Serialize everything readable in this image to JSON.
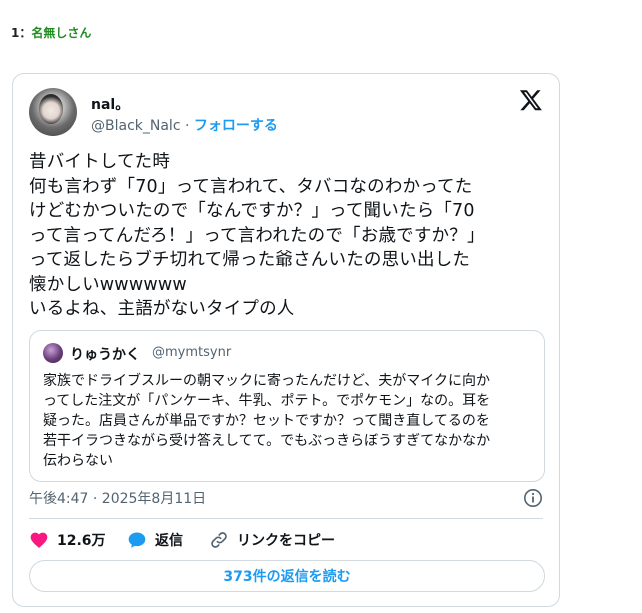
{
  "post": {
    "number": "1",
    "separator": "：",
    "author": "名無しさん"
  },
  "tweet": {
    "user_name": "nal。",
    "handle": "@Black_Nalc",
    "dot": "·",
    "follow_label": "フォローする",
    "text": "昔バイトしてた時\n何も言わず「70」って言われて、タバコなのわかってた\nけどむかついたので「なんですか？」って聞いたら「70\nって言ってんだろ！」って言われたので「お歳ですか？」\nって返したらブチ切れて帰った爺さんいたの思い出した\n懐かしいwwwwww\nいるよね、主語がないタイプの人",
    "quote": {
      "user_name": "りゅうかく",
      "handle": "@mymtsynr",
      "text": "家族でドライブスルーの朝マックに寄ったんだけど、夫がマイクに向か\nってした注文が「パンケーキ、牛乳、ポテト。でポケモン」なの。耳を\n疑った。店員さんが単品ですか？セットですか？って聞き直してるのを\n若干イラつきながら受け答えしてて。でもぶっきらぼうすぎてなかなか\n伝わらない"
    },
    "timestamp": "午後4:47 · 2025年8月11日",
    "likes": "12.6万",
    "reply_label": "返信",
    "copy_link_label": "リンクをコピー",
    "read_replies_label": "373件の返信を読む"
  },
  "icons": {
    "x_logo": "x-logo-icon",
    "info": "info-icon",
    "like": "heart-icon",
    "reply": "speech-bubble-icon",
    "link": "link-icon"
  },
  "colors": {
    "accent": "#1d9bf0",
    "like": "#f91880",
    "author_name": "#228b22",
    "muted": "#536471",
    "border": "#cfd9de"
  }
}
